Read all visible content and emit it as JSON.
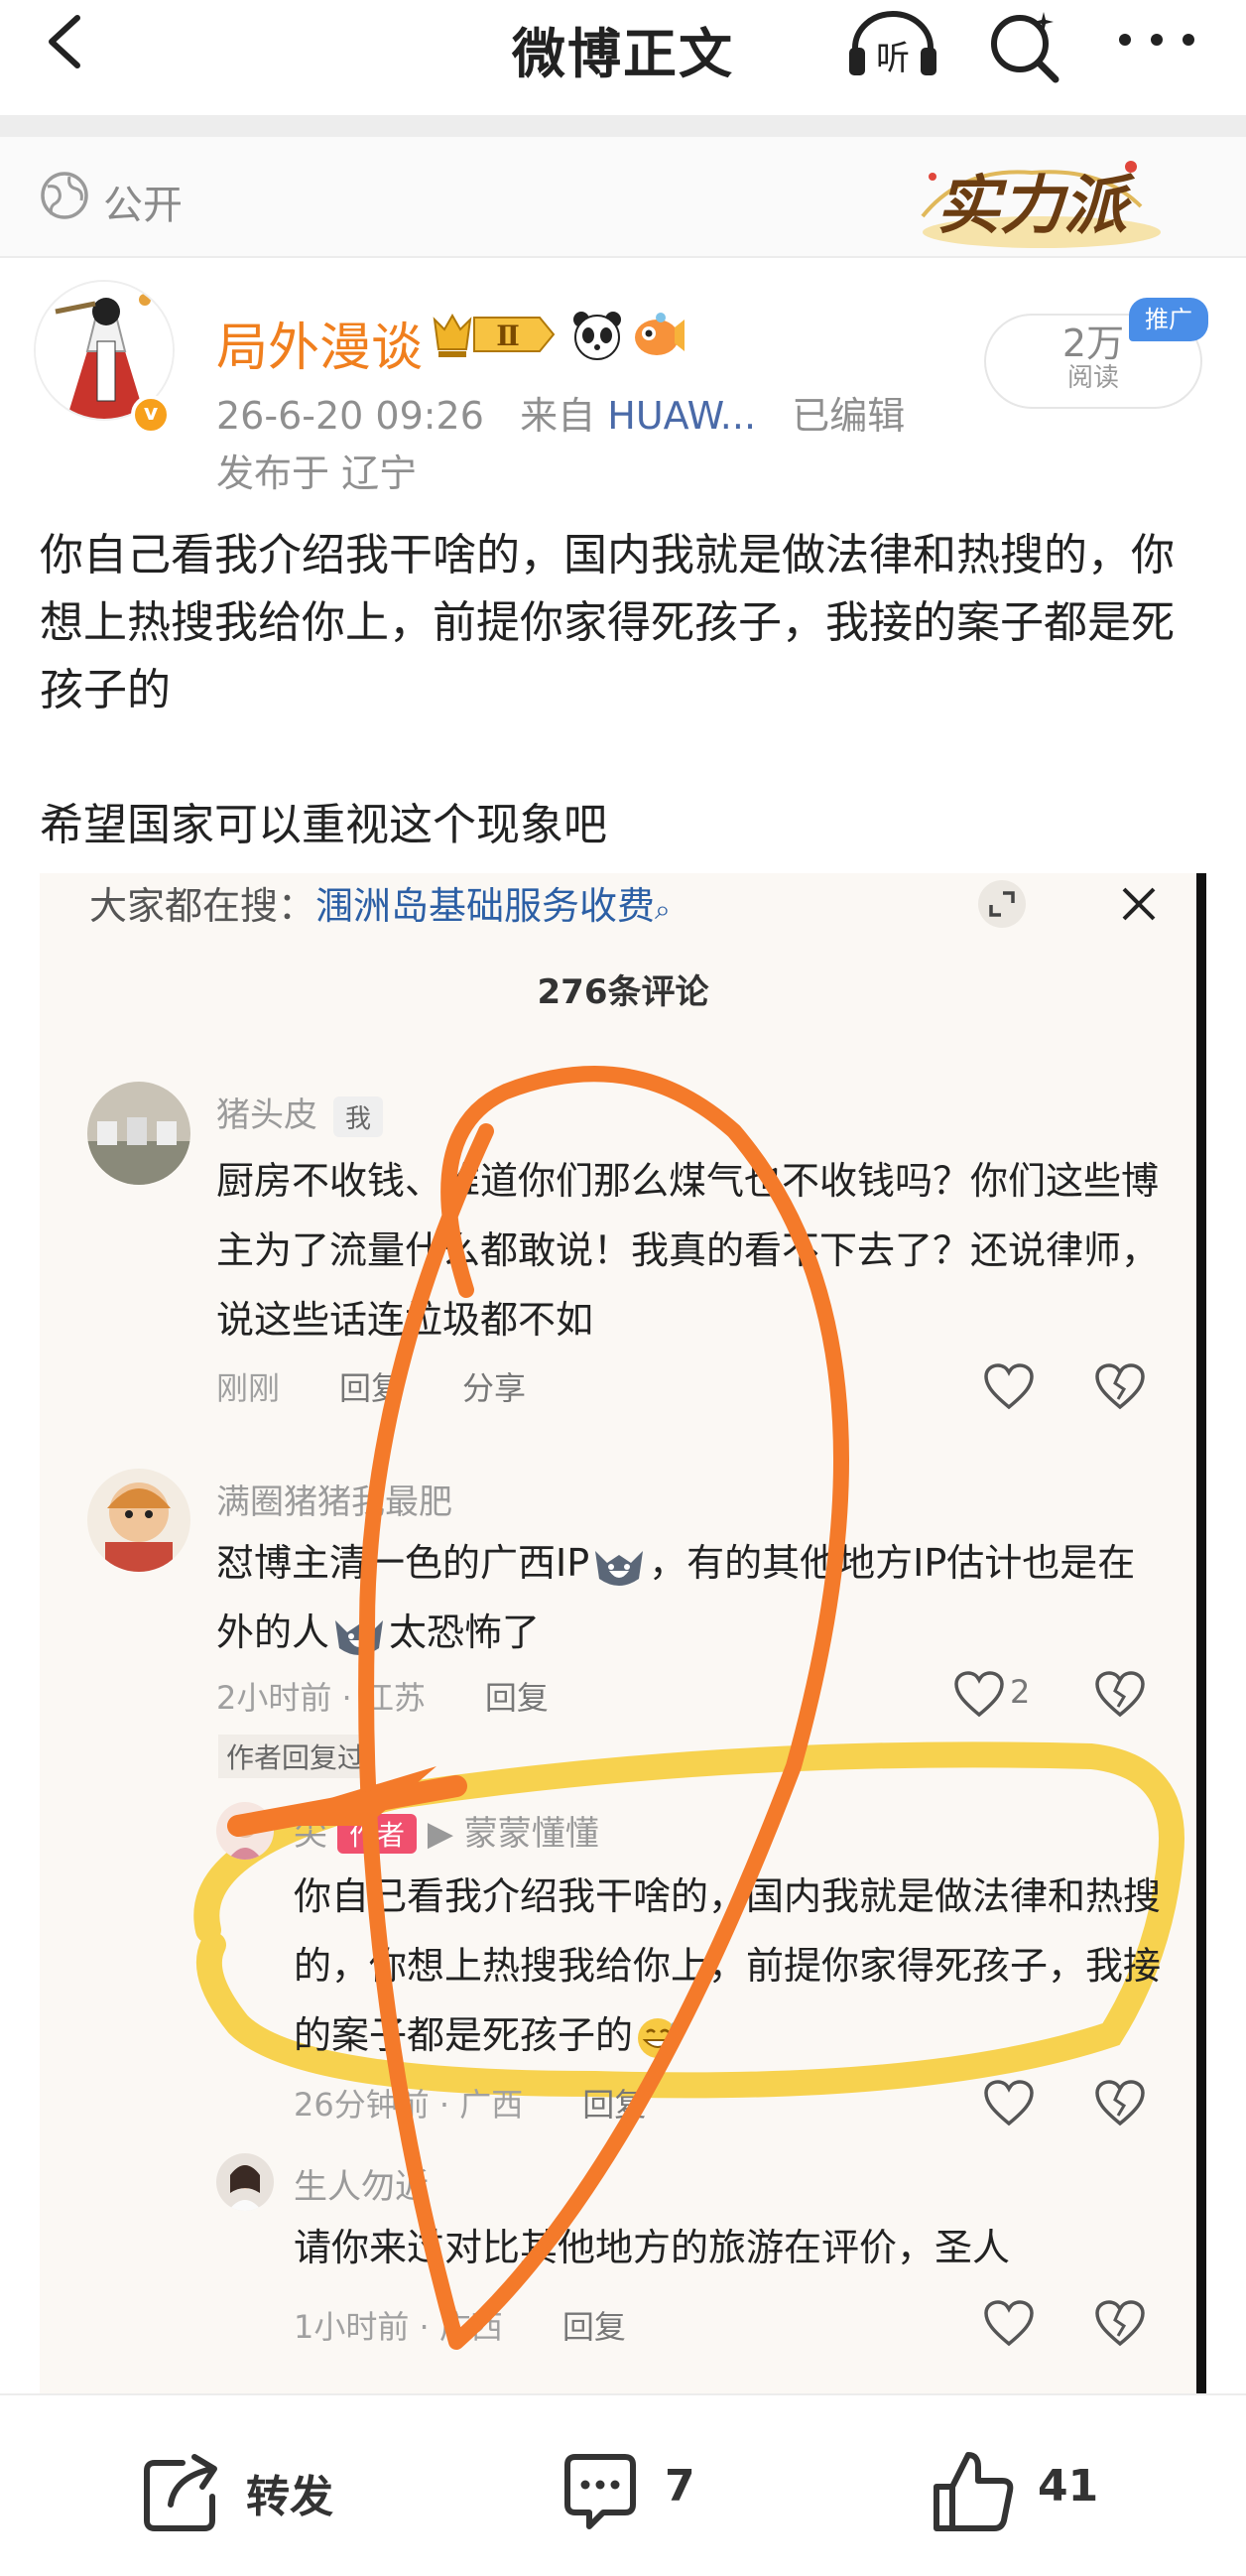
{
  "nav": {
    "title": "微博正文"
  },
  "public_label": "公开",
  "badge_text": "实力派",
  "author": {
    "name": "局外漫谈",
    "level": "Ⅱ",
    "timestamp": "26-6-20 09:26",
    "from_label": "来自",
    "source": "HUAW...",
    "edited": "已编辑",
    "location": "发布于 辽宁",
    "reads": "2万",
    "reads_label": "阅读",
    "promo": "推广"
  },
  "post": {
    "paragraph1": "你自己看我介绍我干啥的，国内我就是做法律和热搜的，你想上热搜我给你上，前提你家得死孩子，我接的案子都是死孩子的",
    "paragraph2": "希望国家可以重视这个现象吧"
  },
  "embed": {
    "search_prefix": "大家都在搜：",
    "search_keyword": "涠洲岛基础服务收费",
    "comment_count": "276条评论",
    "comments": [
      {
        "name": "猪头皮",
        "tag": "我",
        "text": "厨房不收钱、难道你们那么煤气也不收钱吗？你们这些博主为了流量什么都敢说！我真的看不下去了？还说律师，说这些话连垃圾都不如",
        "time": "刚刚",
        "reply": "回复",
        "share": "分享"
      },
      {
        "name": "满圈猪猪我最肥",
        "text_a": "怼博主清一色的广西IP",
        "text_b": "，有的其他地方IP估计也是在外的人",
        "text_c": "太恐怖了",
        "time": "2小时前 · 江苏",
        "reply": "回复",
        "likes": "2",
        "author_replied": "作者回复过"
      },
      {
        "name": "尖",
        "author_tag": "作者",
        "reply_to": "▶ 蒙蒙懂懂",
        "text": "你自己看我介绍我干啥的，国内我就是做法律和热搜的，你想上热搜我给你上，前提你家得死孩子，我接的案子都是死孩子的",
        "time": "26分钟前 · 广西",
        "reply": "回复"
      },
      {
        "name": "生人勿近",
        "text": "请你来过对比其他地方的旅游在评价，圣人",
        "time": "1小时前 · 广西",
        "reply": "回复"
      }
    ]
  },
  "toolbar": {
    "repost_label": "转发",
    "comment_count": "7",
    "like_count": "41"
  },
  "colors": {
    "author_name": "#f07f1e",
    "source_link": "#4a6aa8",
    "scribble_orange": "#f47a2a",
    "highlight_yellow": "#f5c518",
    "author_tag": "#f0506e"
  }
}
